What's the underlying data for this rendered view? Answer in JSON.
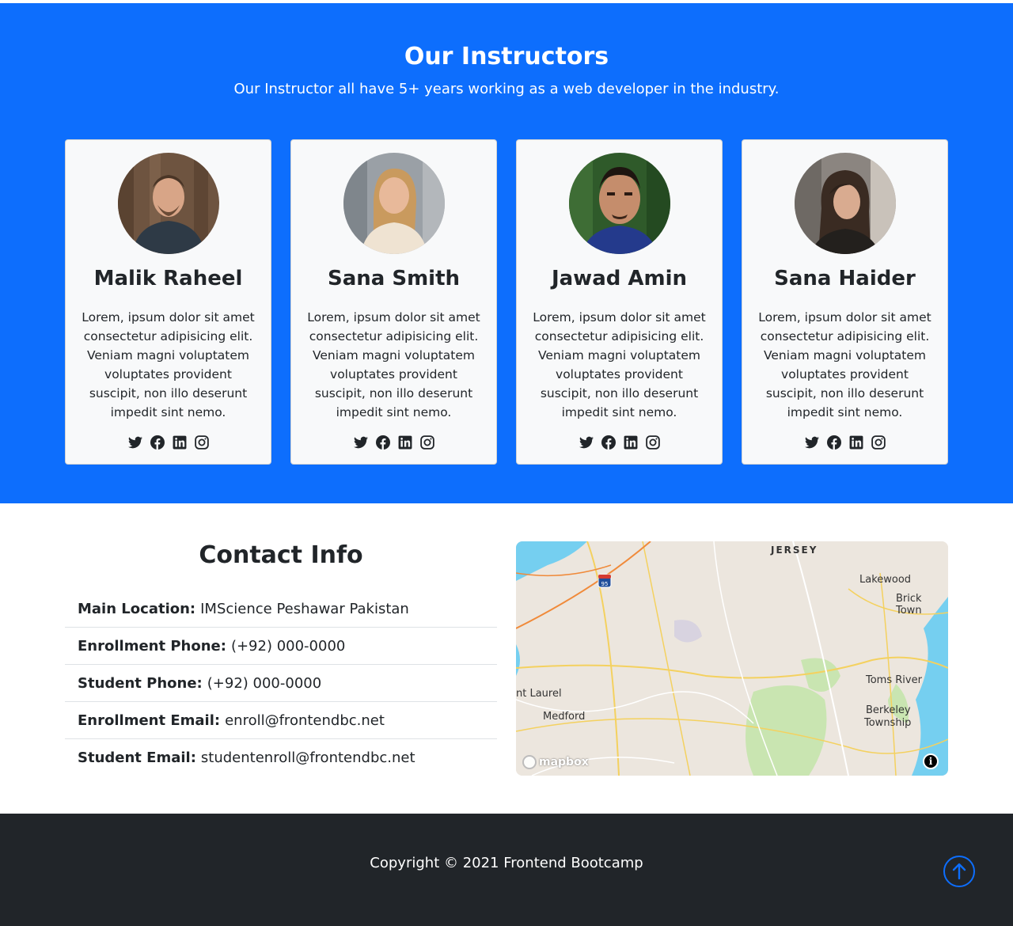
{
  "instructors": {
    "title": "Our Instructors",
    "subtitle": "Our Instructor all have 5+ years working as a web developer in the industry.",
    "bg_color": "#0d6efd",
    "cards": [
      {
        "name": "Malik Raheel",
        "bio": "Lorem, ipsum dolor sit amet consectetur adipisicing elit. Veniam magni voluptatem voluptates provident suscipit, non illo deserunt impedit sint nemo.",
        "socials": [
          "twitter-icon",
          "facebook-icon",
          "linkedin-icon",
          "instagram-icon"
        ]
      },
      {
        "name": "Sana Smith",
        "bio": "Lorem, ipsum dolor sit amet consectetur adipisicing elit. Veniam magni voluptatem voluptates provident suscipit, non illo deserunt impedit sint nemo.",
        "socials": [
          "twitter-icon",
          "facebook-icon",
          "linkedin-icon",
          "instagram-icon"
        ]
      },
      {
        "name": "Jawad Amin",
        "bio": "Lorem, ipsum dolor sit amet consectetur adipisicing elit. Veniam magni voluptatem voluptates provident suscipit, non illo deserunt impedit sint nemo.",
        "socials": [
          "twitter-icon",
          "facebook-icon",
          "linkedin-icon",
          "instagram-icon"
        ]
      },
      {
        "name": "Sana Haider",
        "bio": "Lorem, ipsum dolor sit amet consectetur adipisicing elit. Veniam magni voluptatem voluptates provident suscipit, non illo deserunt impedit sint nemo.",
        "socials": [
          "twitter-icon",
          "facebook-icon",
          "linkedin-icon",
          "instagram-icon"
        ]
      }
    ]
  },
  "contact": {
    "title": "Contact Info",
    "items": [
      {
        "label": "Main Location:",
        "value": "IMScience Peshawar Pakistan"
      },
      {
        "label": "Enrollment Phone:",
        "value": "(+92) 000-0000"
      },
      {
        "label": "Student Phone:",
        "value": "(+92) 000-0000"
      },
      {
        "label": "Enrollment Email:",
        "value": "enroll@frontendbc.net"
      },
      {
        "label": "Student Email:",
        "value": "studentenroll@frontendbc.net"
      }
    ]
  },
  "map": {
    "labels": [
      "JERSEY",
      "Lakewood",
      "Brick Town",
      "Toms River",
      "Berkeley",
      "Township",
      "nt Laurel",
      "Medford"
    ],
    "highway_shield": "95",
    "logo_text": "mapbox",
    "info_icon": "i"
  },
  "footer": {
    "copyright": "Copyright © 2021 Frontend Bootcamp",
    "bg_color": "#212529",
    "to_top_icon": "arrow-up-circle-icon"
  }
}
